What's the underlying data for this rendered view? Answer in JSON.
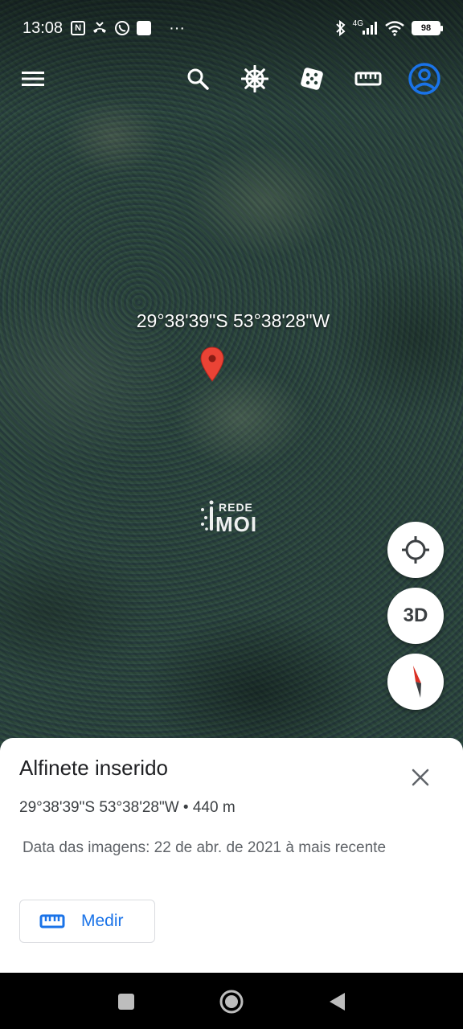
{
  "status_bar": {
    "time": "13:08",
    "left_icons": [
      "nfc-icon",
      "missed-call-icon",
      "whatsapp-icon",
      "notification-square-icon",
      "more-dots-icon"
    ],
    "right_icons": [
      "bluetooth-icon",
      "signal-4g-icon",
      "wifi-icon",
      "battery-icon"
    ],
    "network": "4G",
    "battery": "98",
    "more": "···"
  },
  "toolbar": {
    "icons": [
      "menu-icon",
      "search-icon",
      "voyager-helm-icon",
      "dice-icon",
      "ruler-icon",
      "account-icon"
    ],
    "accent_color": "#1a73e8"
  },
  "map": {
    "pin_coordinates": "29°38'39\"S 53°38'28\"W",
    "pin_color": "#ea4335",
    "watermark_top": "REDE",
    "watermark_bottom": "MOI"
  },
  "fabs": {
    "three_d_label": "3D",
    "icons": [
      "my-location-icon",
      "compass-icon"
    ]
  },
  "sheet": {
    "title": "Alfinete inserido",
    "coords": "29°38'39\"S 53°38'28\"W • 440 m",
    "imagery_date": "Data das imagens: 22 de abr. de 2021 à mais recente",
    "measure_label": "Medir"
  },
  "nav_bar": {
    "icons": [
      "recents-square-icon",
      "home-circle-icon",
      "back-triangle-icon"
    ]
  }
}
